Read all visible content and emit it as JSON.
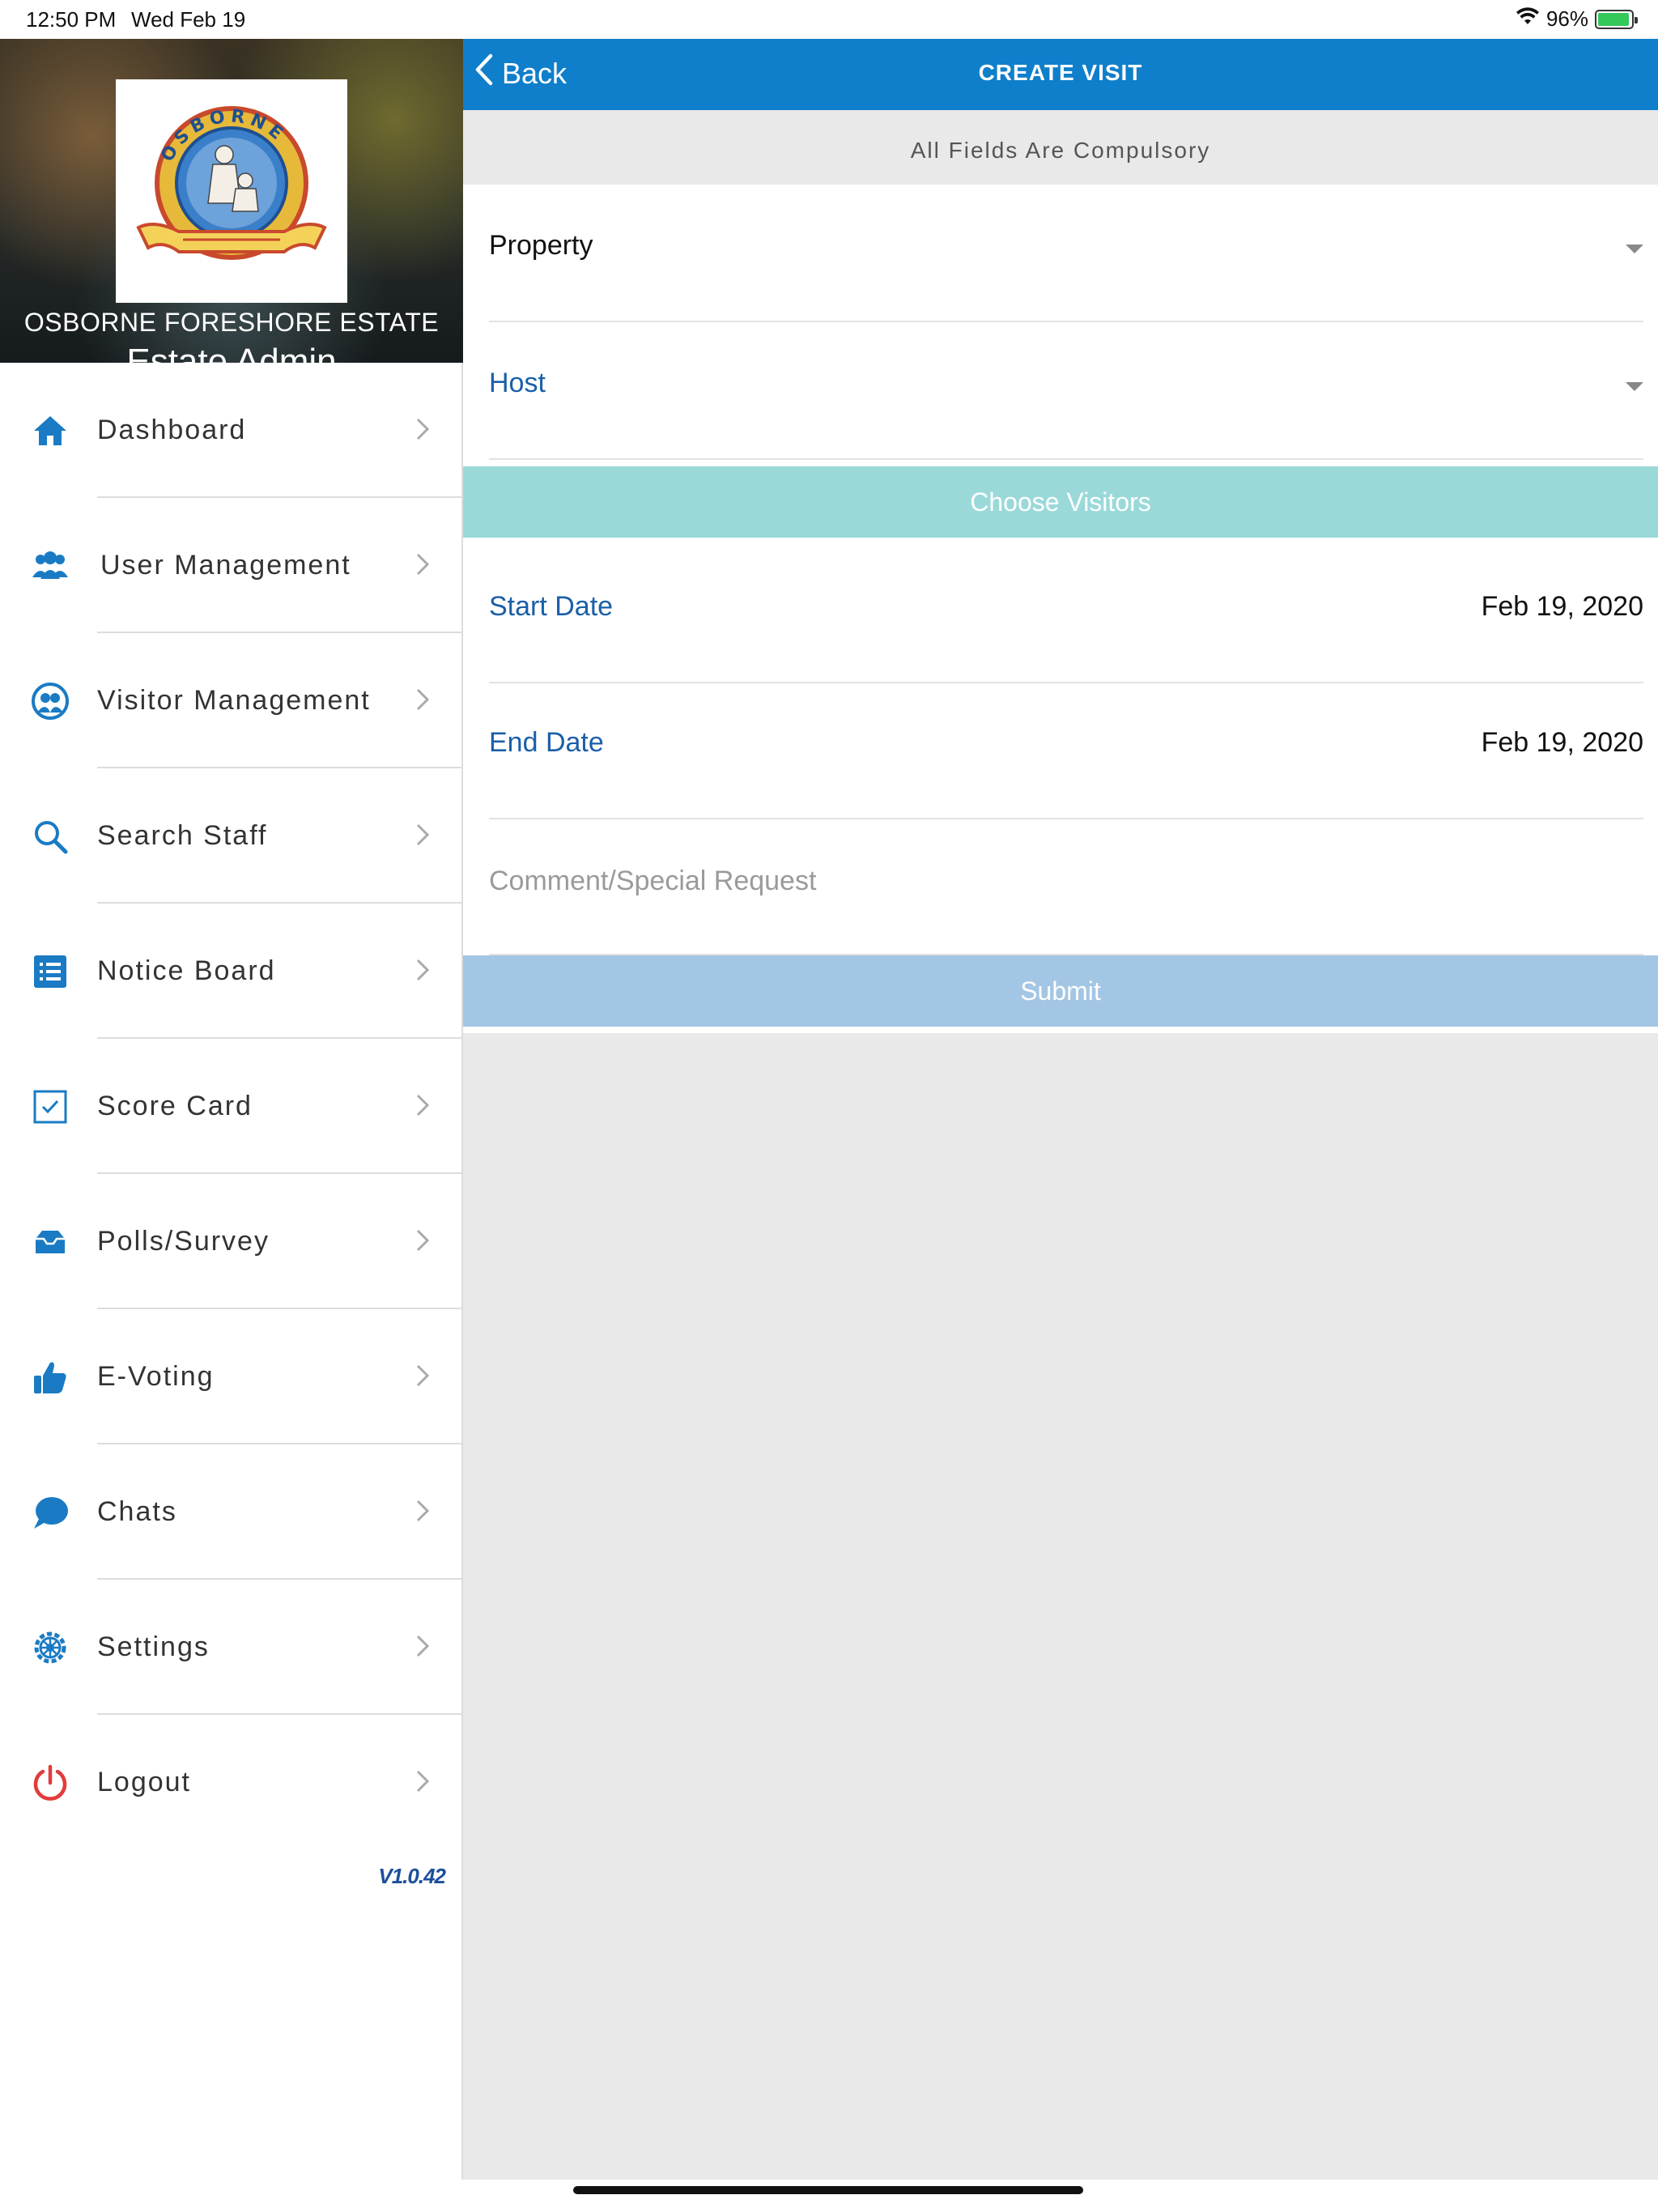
{
  "status_bar": {
    "time": "12:50 PM",
    "date": "Wed Feb 19",
    "battery": "96%",
    "battery_level": 0.96
  },
  "sidebar": {
    "estate_name": "OSBORNE FORESHORE ESTATE",
    "role": "Estate Admin",
    "version": "V1.0.42",
    "items": [
      {
        "label": "Dashboard",
        "icon": "home-icon"
      },
      {
        "label": "User Management",
        "icon": "users-icon"
      },
      {
        "label": "Visitor Management",
        "icon": "visitor-icon"
      },
      {
        "label": "Search Staff",
        "icon": "search-icon"
      },
      {
        "label": "Notice Board",
        "icon": "list-icon"
      },
      {
        "label": "Score Card",
        "icon": "checkbox-icon"
      },
      {
        "label": "Polls/Survey",
        "icon": "inbox-icon"
      },
      {
        "label": "E-Voting",
        "icon": "thumbs-up-icon"
      },
      {
        "label": "Chats",
        "icon": "chat-bubble-icon"
      },
      {
        "label": "Settings",
        "icon": "gear-icon"
      },
      {
        "label": "Logout",
        "icon": "power-icon"
      }
    ]
  },
  "header": {
    "back_label": "Back",
    "title": "CREATE VISIT"
  },
  "form": {
    "notice": "All Fields Are Compulsory",
    "property_label": "Property",
    "host_label": "Host",
    "choose_visitors_label": "Choose Visitors",
    "start_date_label": "Start Date",
    "start_date_value": "Feb 19, 2020",
    "end_date_label": "End Date",
    "end_date_value": "Feb 19, 2020",
    "comment_placeholder": "Comment/Special Request",
    "submit_label": "Submit"
  },
  "colors": {
    "nav_blue": "#0f7fcb",
    "menu_icon_blue": "#1a7bc4",
    "field_label_blue": "#1b5fa8",
    "visitors_button": "#9bd9d9",
    "submit_button": "#a3c6e4",
    "logout_red": "#e23b3b"
  }
}
